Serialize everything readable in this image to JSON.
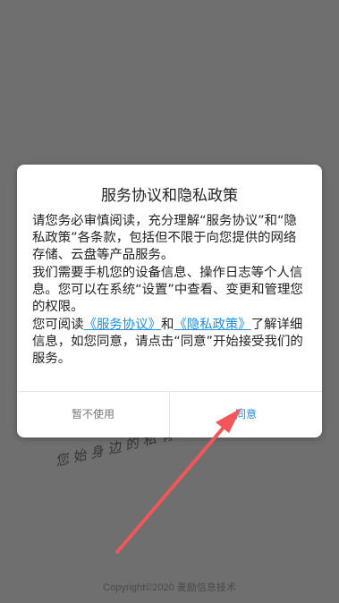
{
  "background": {
    "slogan": "您始身边的私有云存储专家",
    "copyright": "Copyright©2020 麦励信息技术"
  },
  "dialog": {
    "title": "服务协议和隐私政策",
    "paragraph1": "请您务必审慎阅读，充分理解“服务协议”和“隐私政策”各条款，包括但不限于向您提供的网络存储、云盘等产品服务。",
    "paragraph2": "我们需要手机您的设备信息、操作日志等个人信息。您可以在系统“设置”中查看、变更和管理您的权限。",
    "paragraph3_prefix": "您可阅读",
    "link_service": "《服务协议》",
    "paragraph3_and": "和",
    "link_privacy": "《隐私政策》",
    "paragraph3_suffix": "了解详细信息，如您同意，请点击“同意”开始接受我们的服务。",
    "decline_label": "暂不使用",
    "agree_label": "同意"
  },
  "colors": {
    "backdrop": "#6f6f6f",
    "accent": "#1f8fe0",
    "annotation_arrow": "#f0565a"
  },
  "icons": [
    "annotation-arrow-icon"
  ]
}
